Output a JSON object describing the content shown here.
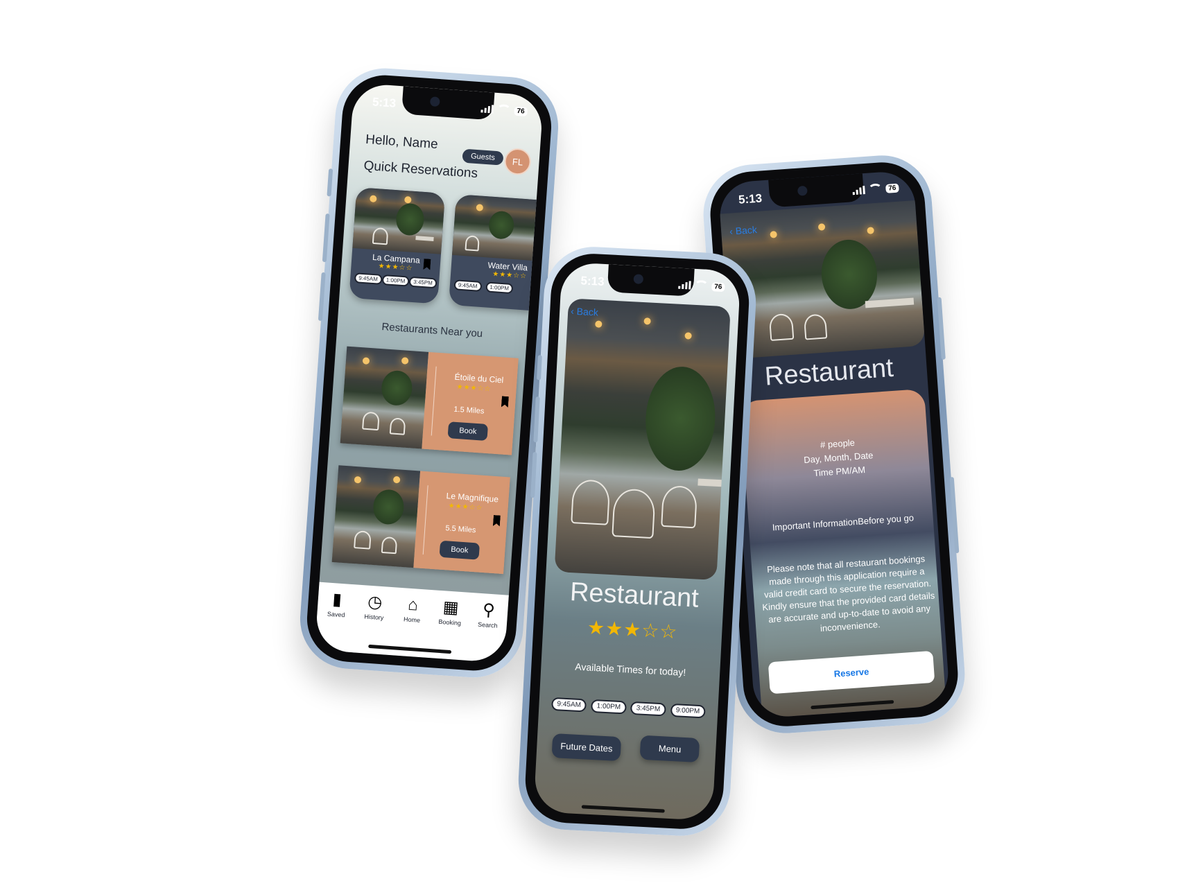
{
  "status": {
    "time": "5:13",
    "battery": "76"
  },
  "home_screen": {
    "greeting": "Hello, Name",
    "quick_reservations_title": "Quick Reservations",
    "guests_label": "Guests",
    "avatar_initials": "FL",
    "quick_cards": [
      {
        "name": "La Campana",
        "stars": "★★★☆☆",
        "times": [
          "9:45AM",
          "1:00PM",
          "3:45PM"
        ]
      },
      {
        "name": "Water Villa",
        "stars": "★★★☆☆",
        "times": [
          "9:45AM",
          "1:00PM"
        ]
      }
    ],
    "near_title": "Restaurants Near you",
    "near_cards": [
      {
        "name": "Étoile du Ciel",
        "stars": "★★★☆☆",
        "distance": "1.5 Miles",
        "button": "Book"
      },
      {
        "name": "Le Magnifique",
        "stars": "★★★☆☆",
        "distance": "5.5 Miles",
        "button": "Book"
      }
    ],
    "tabs": [
      {
        "label": "Saved",
        "icon": "bookmark-icon"
      },
      {
        "label": "History",
        "icon": "clock-icon"
      },
      {
        "label": "Home",
        "icon": "home-icon"
      },
      {
        "label": "Booking",
        "icon": "booking-icon"
      },
      {
        "label": "Search",
        "icon": "search-icon"
      }
    ]
  },
  "detail_screen": {
    "back": "Back",
    "title": "Restaurant",
    "stars": "★★★☆☆",
    "available_label": "Available Times for today!",
    "times": [
      "9:45AM",
      "1:00PM",
      "3:45PM",
      "9:00PM"
    ],
    "future_dates": "Future Dates",
    "menu": "Menu"
  },
  "booking_screen": {
    "back": "Back",
    "title": "Restaurant",
    "people": "# people",
    "date": "Day, Month, Date",
    "time": "Time PM/AM",
    "info_title": "Important InformationBefore you go",
    "info_body": "Please note that all restaurant bookings made through this application require a valid credit card to secure the reservation. Kindly ensure that the provided card details are accurate and up-to-date to avoid any inconvenience.",
    "reserve": "Reserve"
  },
  "colors": {
    "accent": "#d69772",
    "navy": "#2f3a4d",
    "link": "#1677e5",
    "star": "#f2b705"
  }
}
